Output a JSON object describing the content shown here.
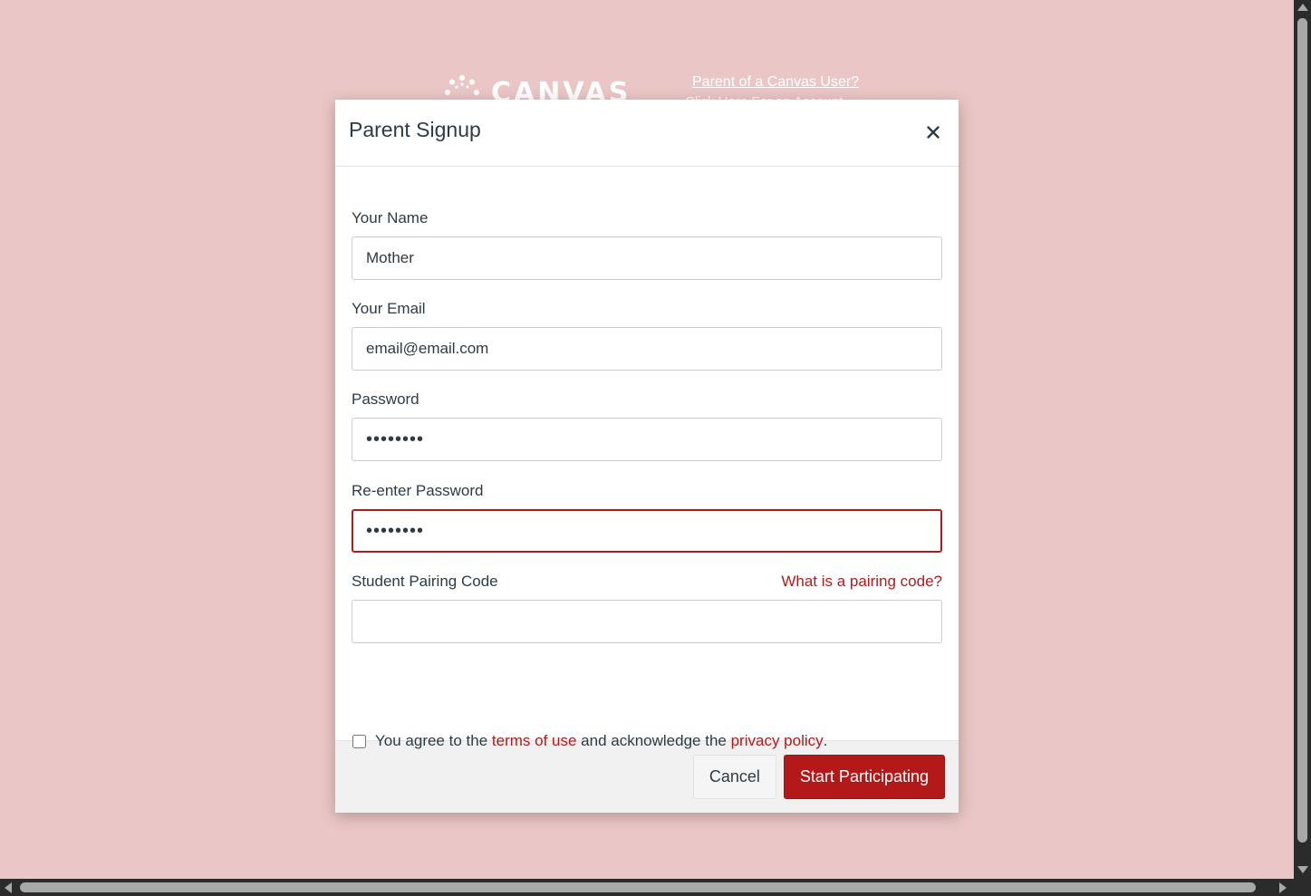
{
  "background": {
    "logo_text": "CANVAS",
    "parent_link": "Parent of a Canvas User?",
    "parent_sub": "Click Here For an Account"
  },
  "modal": {
    "title": "Parent Signup",
    "close_label": "×",
    "fields": {
      "name": {
        "label": "Your Name",
        "value": "Mother"
      },
      "email": {
        "label": "Your Email",
        "value": "email@email.com"
      },
      "password": {
        "label": "Password",
        "value": "••••••••"
      },
      "reenter": {
        "label": "Re-enter Password",
        "value": "••••••••"
      },
      "pairing": {
        "label": "Student Pairing Code",
        "value": "",
        "help_link": "What is a pairing code?"
      }
    },
    "agree": {
      "prefix": "You agree to the",
      "terms": "terms of use",
      "middle": "and acknowledge the",
      "privacy": "privacy policy",
      "suffix": ".",
      "checked": false
    },
    "buttons": {
      "cancel": "Cancel",
      "submit": "Start Participating"
    }
  },
  "colors": {
    "page_bg": "#ebc6c6",
    "accent": "#b41919",
    "text": "#2d3b45"
  }
}
